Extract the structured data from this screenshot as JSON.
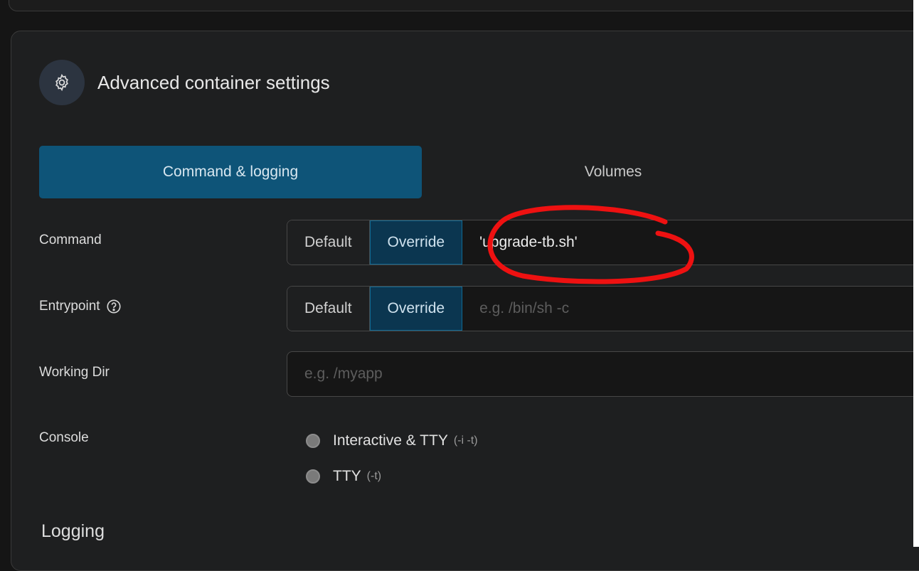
{
  "header": {
    "title": "Advanced container settings",
    "icon": "gear-icon"
  },
  "tabs": [
    {
      "label": "Command & logging",
      "active": true
    },
    {
      "label": "Volumes",
      "active": false
    }
  ],
  "fields": {
    "command": {
      "label": "Command",
      "mode_default": "Default",
      "mode_override": "Override",
      "selected_mode": "Override",
      "value": "'upgrade-tb.sh'"
    },
    "entrypoint": {
      "label": "Entrypoint",
      "help_icon": "help-circle-icon",
      "mode_default": "Default",
      "mode_override": "Override",
      "selected_mode": "Override",
      "placeholder": "e.g. /bin/sh -c"
    },
    "working_dir": {
      "label": "Working Dir",
      "placeholder": "e.g. /myapp"
    },
    "console": {
      "label": "Console",
      "options": [
        {
          "label": "Interactive & TTY",
          "hint": "(-i -t)"
        },
        {
          "label": "TTY",
          "hint": "(-t)"
        }
      ]
    }
  },
  "logging": {
    "heading": "Logging"
  },
  "colors": {
    "accent": "#0e5478",
    "selected_segment": "#0b3650",
    "annotation_red": "#ee1111"
  }
}
